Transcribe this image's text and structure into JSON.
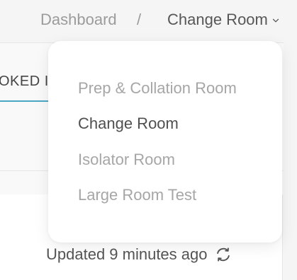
{
  "breadcrumb": {
    "root": "Dashboard",
    "separator": "/",
    "current": "Change Room",
    "chevron_icon": "chevron-down-icon"
  },
  "tabs": {
    "booked_label": "OKED II"
  },
  "dropdown": {
    "items": [
      {
        "label": "Prep & Collation Room",
        "state": "muted"
      },
      {
        "label": "Change Room",
        "state": "selected"
      },
      {
        "label": "Isolator Room",
        "state": "muted"
      },
      {
        "label": "Large Room Test",
        "state": "muted"
      }
    ]
  },
  "status": {
    "updated_text": "Updated 9 minutes ago",
    "refresh_icon": "refresh-icon"
  },
  "colors": {
    "background": "#f5f5f5",
    "panel": "#ffffff",
    "muted_text": "#9b9b9b",
    "primary_text": "#4f4f4f",
    "tab_accent": "#4aa8c4"
  }
}
